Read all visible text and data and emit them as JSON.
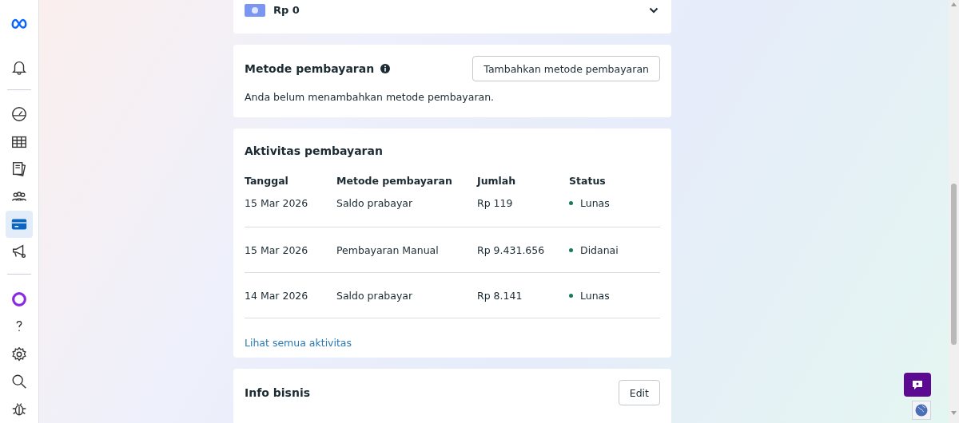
{
  "sidebar": {
    "items": [
      {
        "kind": "logo",
        "selected": false
      },
      {
        "kind": "bell",
        "selected": false
      },
      {
        "kind": "gauge",
        "selected": false
      },
      {
        "kind": "table",
        "selected": false
      },
      {
        "kind": "pages",
        "selected": false
      },
      {
        "kind": "people",
        "selected": false
      },
      {
        "kind": "card",
        "selected": true
      },
      {
        "kind": "megaphone",
        "selected": false
      },
      {
        "kind": "ring",
        "selected": false
      },
      {
        "kind": "help",
        "selected": false
      },
      {
        "kind": "settings",
        "selected": false
      },
      {
        "kind": "search",
        "selected": false
      },
      {
        "kind": "bug",
        "selected": false
      }
    ]
  },
  "balance": {
    "amount": "Rp 0"
  },
  "payment_method": {
    "title": "Metode pembayaran",
    "button": "Tambahkan metode pembayaran",
    "message": "Anda belum menambahkan metode pembayaran."
  },
  "payment_activity": {
    "title": "Aktivitas pembayaran",
    "columns": [
      "Tanggal",
      "Metode pembayaran",
      "Jumlah",
      "Status"
    ],
    "rows": [
      {
        "date": "15 Mar 2026",
        "method": "Saldo prabayar",
        "amount": "Rp 119",
        "status": "Lunas"
      },
      {
        "date": "15 Mar 2026",
        "method": "Pembayaran Manual",
        "amount": "Rp 9.431.656",
        "status": "Didanai"
      },
      {
        "date": "14 Mar 2026",
        "method": "Saldo prabayar",
        "amount": "Rp 8.141",
        "status": "Lunas"
      }
    ],
    "link": "Lihat semua aktivitas"
  },
  "business_info": {
    "title": "Info bisnis",
    "button": "Edit"
  }
}
